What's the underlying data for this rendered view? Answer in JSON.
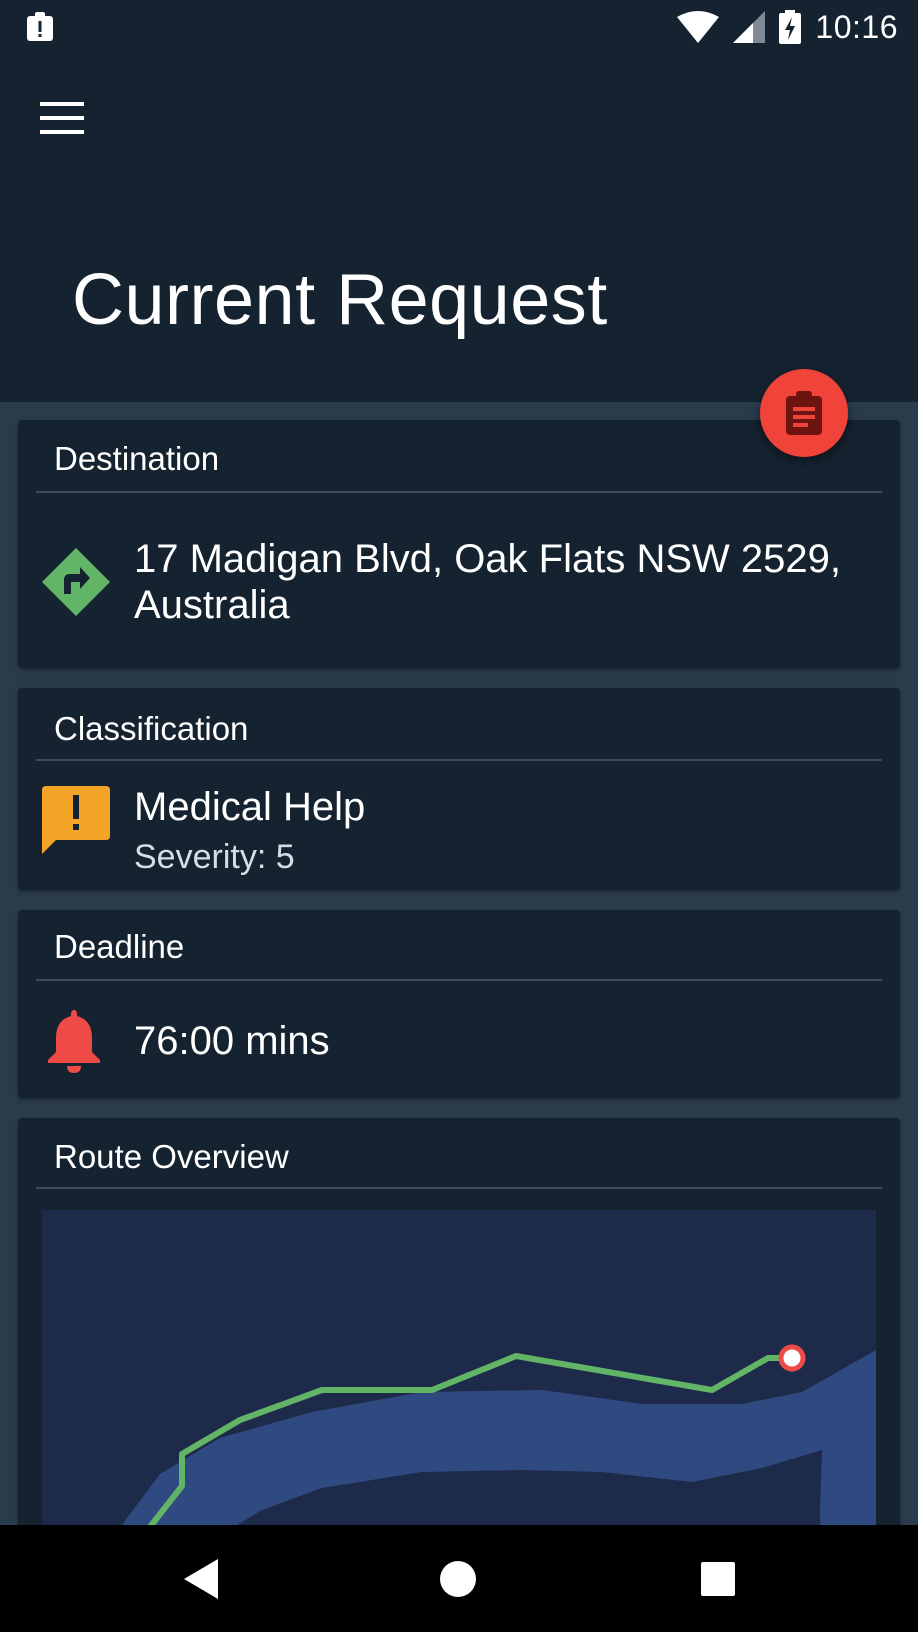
{
  "status_bar": {
    "time": "10:16",
    "notification_icon": "clipboard-alert-icon",
    "wifi_icon": "wifi-icon",
    "signal_icon": "cell-signal-icon",
    "battery_icon": "battery-charging-icon"
  },
  "app_bar": {
    "menu_icon": "hamburger-menu-icon",
    "title": "Current Request",
    "fab_icon": "clipboard-text-icon"
  },
  "cards": {
    "destination": {
      "header": "Destination",
      "icon": "directions-diamond-icon",
      "address_line1": "17 Madigan Blvd, Oak Flats NSW 2529,",
      "address_line2": "Australia"
    },
    "classification": {
      "header": "Classification",
      "icon": "alert-message-icon",
      "type": "Medical Help",
      "severity_label": "Severity:",
      "severity_value": "5"
    },
    "deadline": {
      "header": "Deadline",
      "icon": "bell-icon",
      "value": "76:00 mins"
    },
    "route": {
      "header": "Route Overview"
    }
  },
  "colors": {
    "background": "#2a3c4c",
    "card": "#152230",
    "accent_red": "#f0433a",
    "route_green": "#62b567",
    "warning_orange": "#f4a427",
    "map_land": "#1e2a4a",
    "map_water": "#2f4a80"
  },
  "nav_bar": {
    "back_icon": "back-triangle-icon",
    "home_icon": "home-circle-icon",
    "recents_icon": "recents-square-icon"
  }
}
